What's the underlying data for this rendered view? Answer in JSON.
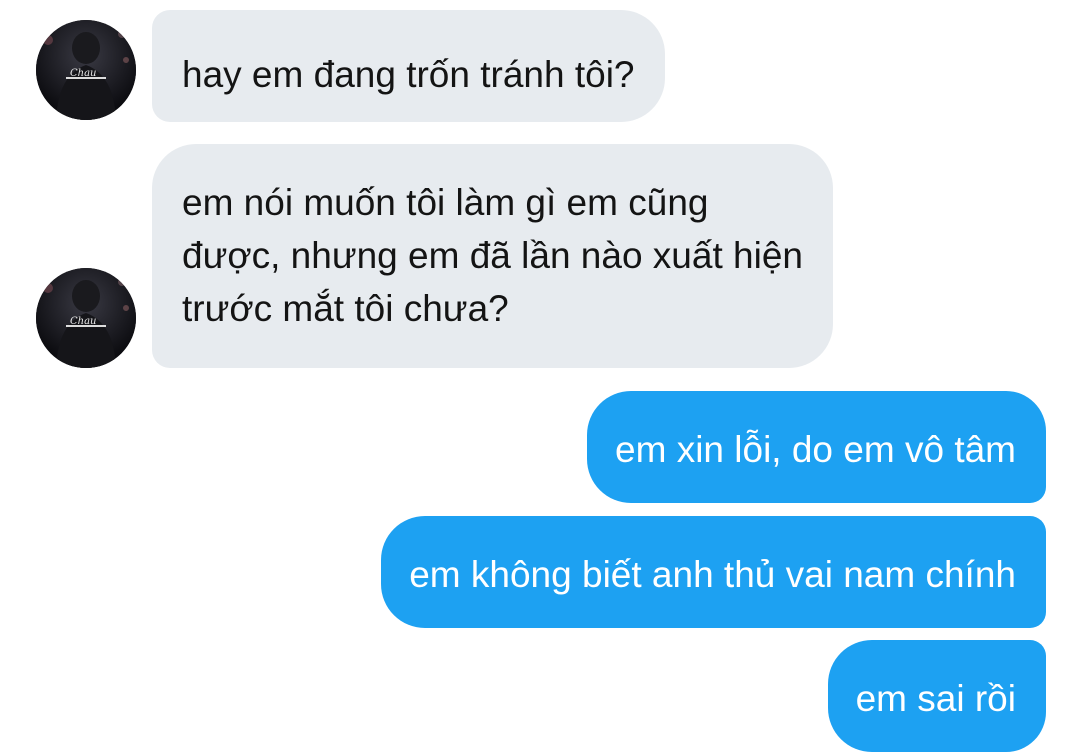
{
  "conversation": {
    "messages": [
      {
        "sender": "contact",
        "lines": [
          "hay em đang trốn tránh tôi?"
        ]
      },
      {
        "sender": "contact",
        "lines": [
          "em nói muốn tôi làm gì em cũng",
          "được, nhưng em đã lần nào xuất hiện",
          "trước mắt tôi chưa?"
        ]
      },
      {
        "sender": "me",
        "lines": [
          "em xin lỗi, do em vô tâm"
        ]
      },
      {
        "sender": "me",
        "lines": [
          "em không biết anh thủ vai nam chính"
        ]
      },
      {
        "sender": "me",
        "lines": [
          "em sai rồi"
        ]
      }
    ],
    "avatar_text": "Chau"
  },
  "colors": {
    "incoming_bubble": "#e7ebef",
    "incoming_text": "#141414",
    "outgoing_bubble": "#1da1f2",
    "outgoing_text": "#ffffff"
  }
}
